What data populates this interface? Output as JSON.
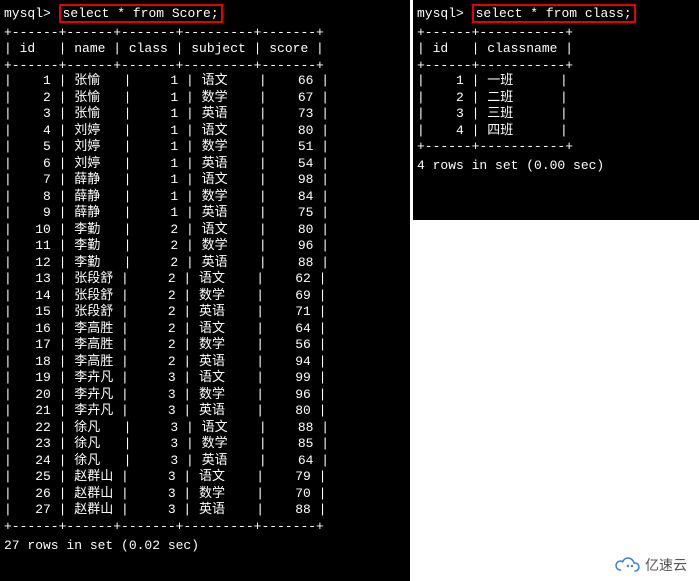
{
  "left": {
    "prompt": "mysql>",
    "command": "select * from Score;",
    "divider": "+------+------+-------+---------+-------+",
    "header": "| id   | name | class | subject | score |",
    "rows": [
      {
        "id": "1",
        "name": "张愉",
        "class": "1",
        "subject": "语文",
        "score": "66"
      },
      {
        "id": "2",
        "name": "张愉",
        "class": "1",
        "subject": "数学",
        "score": "67"
      },
      {
        "id": "3",
        "name": "张愉",
        "class": "1",
        "subject": "英语",
        "score": "73"
      },
      {
        "id": "4",
        "name": "刘婷",
        "class": "1",
        "subject": "语文",
        "score": "80"
      },
      {
        "id": "5",
        "name": "刘婷",
        "class": "1",
        "subject": "数学",
        "score": "51"
      },
      {
        "id": "6",
        "name": "刘婷",
        "class": "1",
        "subject": "英语",
        "score": "54"
      },
      {
        "id": "7",
        "name": "薛静",
        "class": "1",
        "subject": "语文",
        "score": "98"
      },
      {
        "id": "8",
        "name": "薛静",
        "class": "1",
        "subject": "数学",
        "score": "84"
      },
      {
        "id": "9",
        "name": "薛静",
        "class": "1",
        "subject": "英语",
        "score": "75"
      },
      {
        "id": "10",
        "name": "李勤",
        "class": "2",
        "subject": "语文",
        "score": "80"
      },
      {
        "id": "11",
        "name": "李勤",
        "class": "2",
        "subject": "数学",
        "score": "96"
      },
      {
        "id": "12",
        "name": "李勤",
        "class": "2",
        "subject": "英语",
        "score": "88"
      },
      {
        "id": "13",
        "name": "张段舒",
        "class": "2",
        "subject": "语文",
        "score": "62"
      },
      {
        "id": "14",
        "name": "张段舒",
        "class": "2",
        "subject": "数学",
        "score": "69"
      },
      {
        "id": "15",
        "name": "张段舒",
        "class": "2",
        "subject": "英语",
        "score": "71"
      },
      {
        "id": "16",
        "name": "李高胜",
        "class": "2",
        "subject": "语文",
        "score": "64"
      },
      {
        "id": "17",
        "name": "李高胜",
        "class": "2",
        "subject": "数学",
        "score": "56"
      },
      {
        "id": "18",
        "name": "李高胜",
        "class": "2",
        "subject": "英语",
        "score": "94"
      },
      {
        "id": "19",
        "name": "李卉凡",
        "class": "3",
        "subject": "语文",
        "score": "99"
      },
      {
        "id": "20",
        "name": "李卉凡",
        "class": "3",
        "subject": "数学",
        "score": "96"
      },
      {
        "id": "21",
        "name": "李卉凡",
        "class": "3",
        "subject": "英语",
        "score": "80"
      },
      {
        "id": "22",
        "name": "徐凡",
        "class": "3",
        "subject": "语文",
        "score": "88"
      },
      {
        "id": "23",
        "name": "徐凡",
        "class": "3",
        "subject": "数学",
        "score": "85"
      },
      {
        "id": "24",
        "name": "徐凡",
        "class": "3",
        "subject": "英语",
        "score": "64"
      },
      {
        "id": "25",
        "name": "赵群山",
        "class": "3",
        "subject": "语文",
        "score": "79"
      },
      {
        "id": "26",
        "name": "赵群山",
        "class": "3",
        "subject": "数学",
        "score": "70"
      },
      {
        "id": "27",
        "name": "赵群山",
        "class": "3",
        "subject": "英语",
        "score": "88"
      }
    ],
    "status": "27 rows in set (0.02 sec)"
  },
  "right": {
    "prompt": "mysql>",
    "command": "select * from class;",
    "divider": "+------+-----------+",
    "header": "| id   | classname |",
    "rows": [
      {
        "id": "1",
        "classname": "一班"
      },
      {
        "id": "2",
        "classname": "二班"
      },
      {
        "id": "3",
        "classname": "三班"
      },
      {
        "id": "4",
        "classname": "四班"
      }
    ],
    "status": "4 rows in set (0.00 sec)"
  },
  "watermark": {
    "text": "亿速云"
  }
}
